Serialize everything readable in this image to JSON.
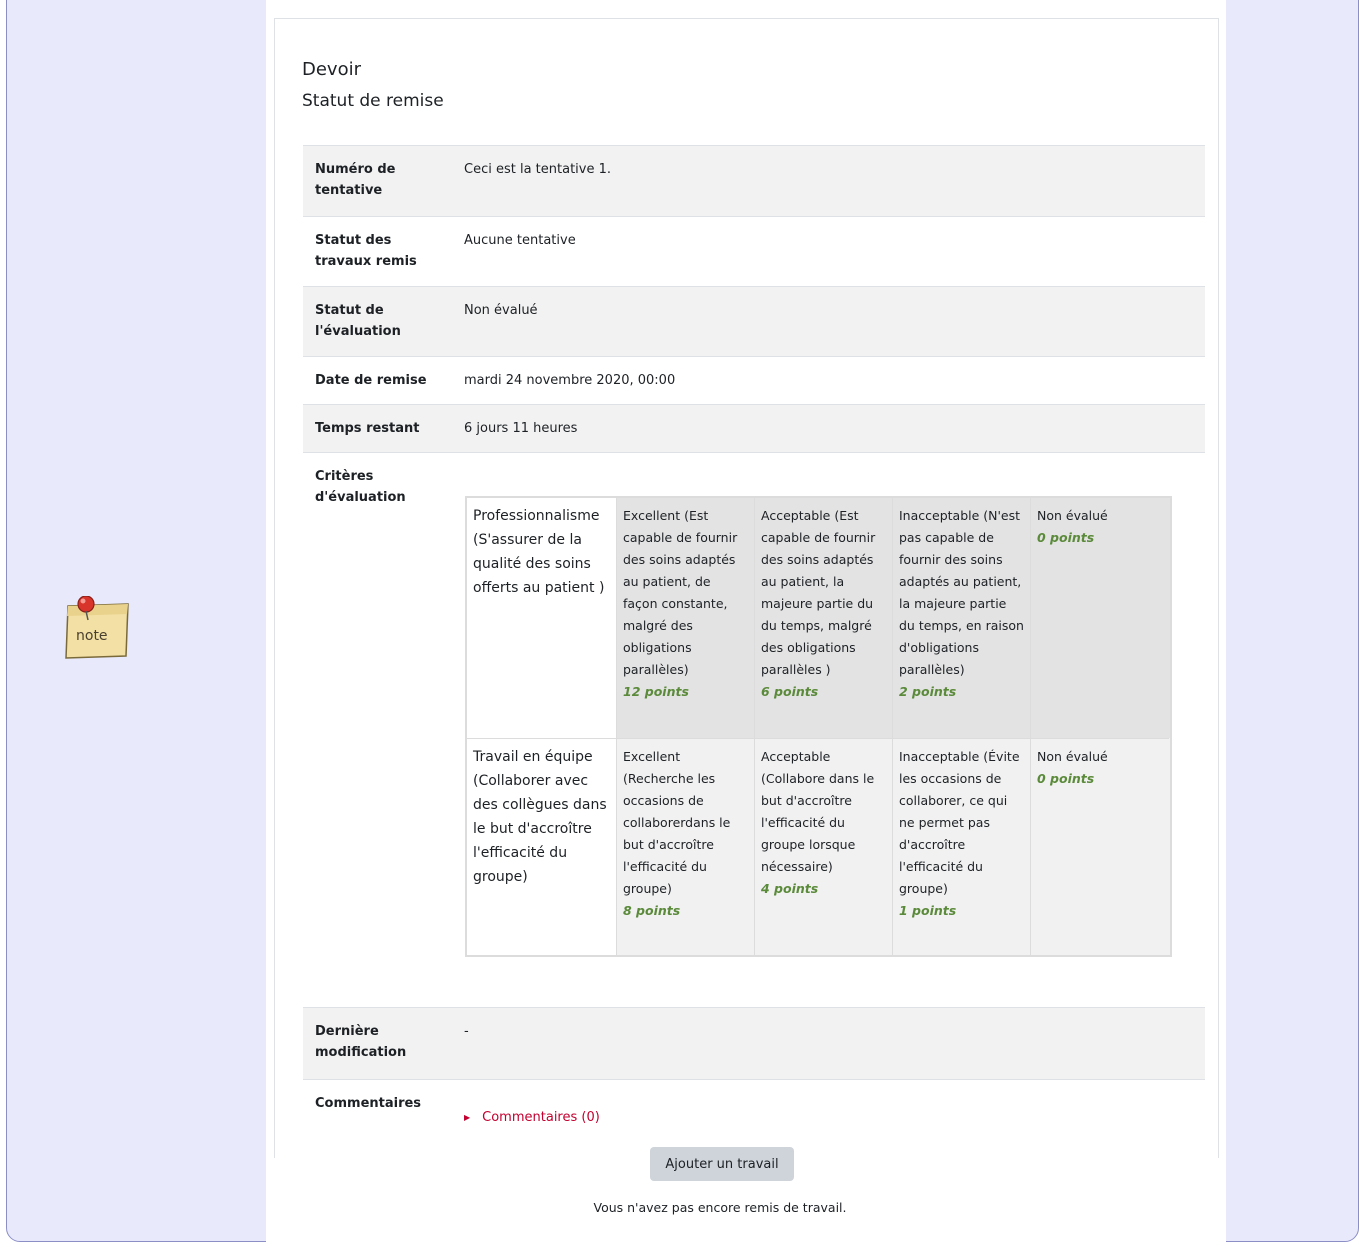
{
  "assignment": {
    "title": "Devoir",
    "subtitle": "Statut de remise"
  },
  "note_icon": {
    "icon": "note-icon",
    "label": "note"
  },
  "summary": {
    "attempt_label": "Numéro de tentative",
    "attempt_value": "Ceci est la tentative 1.",
    "submission_label": "Statut des travaux remis",
    "submission_value": "Aucune tentative",
    "grading_label": "Statut de l'évaluation",
    "grading_value": "Non évalué",
    "due_label": "Date de remise",
    "due_value": "mardi 24 novembre 2020, 00:00",
    "remaining_label": "Temps restant",
    "remaining_value": "6 jours 11 heures",
    "criteria_label": "Critères d'évaluation",
    "modified_label": "Dernière modification",
    "modified_value": "-",
    "comments_label": "Commentaires",
    "comments_link": "Commentaires (0)"
  },
  "rubric": {
    "criteria": [
      {
        "description": "Professionnalisme (S'assurer de la qualité des soins offerts au patient )",
        "levels": [
          {
            "definition": "Excellent (Est capable de fournir des soins adaptés au patient, de façon constante, malgré des obligations parallèles)",
            "points": "12 points"
          },
          {
            "definition": "Acceptable (Est capable de fournir des soins adaptés au patient, la majeure partie du du temps, malgré des obligations parallèles )",
            "points": "6 points"
          },
          {
            "definition": "Inacceptable (N'est pas capable de fournir des soins adaptés au patient, la majeure partie du temps, en raison d'obligations parallèles)",
            "points": "2 points"
          },
          {
            "definition": "Non évalué",
            "points": "0 points"
          }
        ]
      },
      {
        "description": "Travail en équipe (Collaborer avec des collègues dans le but d'accroître l'efficacité du groupe)",
        "levels": [
          {
            "definition": "Excellent (Recherche les occasions de collaborerdans le but d'accroître l'efficacité du groupe)",
            "points": "8 points"
          },
          {
            "definition": "Acceptable (Collabore dans le but d'accroître l'efficacité du groupe lorsque nécessaire)",
            "points": "4 points"
          },
          {
            "definition": "Inacceptable (Évite les occasions de collaborer, ce qui ne permet pas d'accroître l'efficacité du groupe)",
            "points": "1 points"
          },
          {
            "definition": "Non évalué",
            "points": "0 points"
          }
        ]
      }
    ]
  },
  "actions": {
    "add_submission": "Ajouter un travail",
    "no_submission_msg": "Vous n'avez pas encore remis de travail."
  }
}
